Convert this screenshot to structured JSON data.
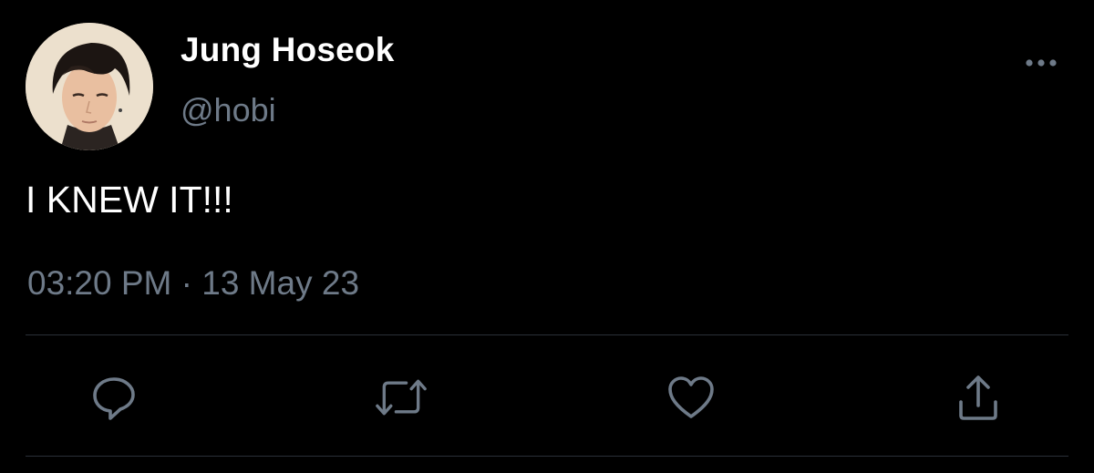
{
  "author": {
    "display_name": "Jung Hoseok",
    "handle": "@hobi",
    "avatar_icon": "profile-photo"
  },
  "tweet": {
    "text": "I KNEW IT!!!",
    "timestamp": "03:20 PM · 13 May 23"
  },
  "actions": [
    {
      "name": "reply",
      "icon": "reply-icon"
    },
    {
      "name": "retweet",
      "icon": "retweet-icon"
    },
    {
      "name": "like",
      "icon": "heart-icon"
    },
    {
      "name": "share",
      "icon": "share-icon"
    }
  ],
  "colors": {
    "background": "#000000",
    "primary_text": "#ffffff",
    "secondary_text": "#6e7a88",
    "divider": "#2a3038"
  }
}
